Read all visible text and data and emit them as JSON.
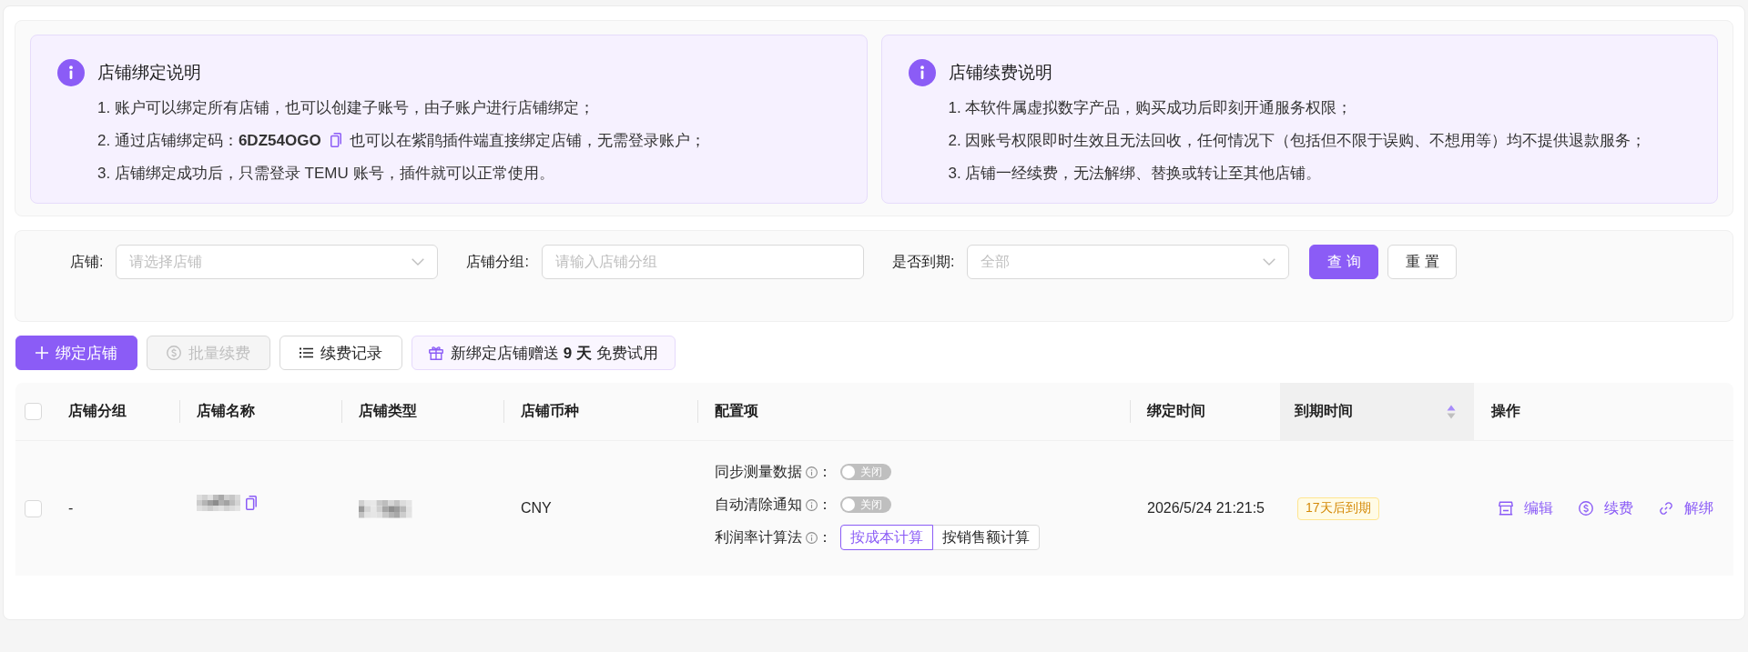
{
  "notices": [
    {
      "title": "店铺绑定说明",
      "items": [
        {
          "kind": "text",
          "text": "1. 账户可以绑定所有店铺，也可以创建子账号，由子账户进行店铺绑定；"
        },
        {
          "kind": "code",
          "text": "2. 通过店铺绑定码：**6DZ54OGO**",
          "after": "也可以在紫鹃插件端直接绑定店铺，无需登录账户；"
        },
        {
          "kind": "text",
          "text": "3. 店铺绑定成功后，只需登录 TEMU 账号，插件就可以正常使用。"
        }
      ]
    },
    {
      "title": "店铺续费说明",
      "items": [
        {
          "kind": "text",
          "text": "1. 本软件属虚拟数字产品，购买成功后即刻开通服务权限；"
        },
        {
          "kind": "text",
          "text": "2. 因账号权限即时生效且无法回收，任何情况下（包括但不限于误购、不想用等）均不提供退款服务；"
        },
        {
          "kind": "text",
          "text": "3. 店铺一经续费，无法解绑、替换或转让至其他店铺。"
        }
      ]
    }
  ],
  "filters": {
    "fields": [
      {
        "label": "店铺:",
        "kind": "select",
        "placeholder": "请选择店铺"
      },
      {
        "label": "店铺分组:",
        "kind": "input",
        "placeholder": "请输入店铺分组"
      },
      {
        "label": "是否到期:",
        "kind": "select",
        "placeholder": "全部"
      }
    ],
    "buttons": [
      {
        "label": "查 询",
        "kind": "primary"
      },
      {
        "label": "重 置",
        "kind": "default"
      }
    ]
  },
  "toolbar": {
    "buttons": [
      {
        "label": "绑定店铺",
        "kind": "primary",
        "disabled": false
      },
      {
        "label": "批量续费",
        "kind": "default",
        "disabled": true
      },
      {
        "label": "续费记录",
        "kind": "default",
        "disabled": false
      }
    ],
    "promo": {
      "text": "新绑定店铺赠送 **9 天** 免费试用"
    }
  },
  "table": {
    "select_all": {
      "checked": false
    },
    "columns": [
      {
        "label": "店铺分组",
        "sorted": false
      },
      {
        "label": "店铺名称",
        "sorted": false
      },
      {
        "label": "店铺类型",
        "sorted": false
      },
      {
        "label": "店铺币种",
        "sorted": false
      },
      {
        "label": "配置项",
        "sorted": false
      },
      {
        "label": "绑定时间",
        "sorted": false
      },
      {
        "label": "到期时间",
        "sorted": true
      },
      {
        "label": "操作",
        "sorted": false
      }
    ],
    "rows": [
      {
        "checked": false,
        "group": "-",
        "name": {
          "kind": "redacted",
          "copy": true
        },
        "type": {
          "kind": "redacted"
        },
        "currency": "CNY",
        "settings": [
          {
            "kind": "switch",
            "label": "同步测量数据",
            "suffix": "：",
            "on": false,
            "text": "关闭"
          },
          {
            "kind": "switch",
            "label": "自动清除通知",
            "suffix": "：",
            "on": false,
            "text": "关闭"
          },
          {
            "kind": "segmented",
            "label": "利润率计算法",
            "suffix": "：",
            "options": [
              {
                "label": "按成本计算",
                "selected": true
              },
              {
                "label": "按销售额计算",
                "selected": false
              }
            ]
          }
        ],
        "bound_at": "2026/5/24 21:21:5",
        "expiry": {
          "text": "17天后到期",
          "expiring_soon": true
        },
        "actions": [
          {
            "label": "编辑"
          },
          {
            "label": "续费"
          },
          {
            "label": "解绑"
          }
        ]
      }
    ]
  }
}
